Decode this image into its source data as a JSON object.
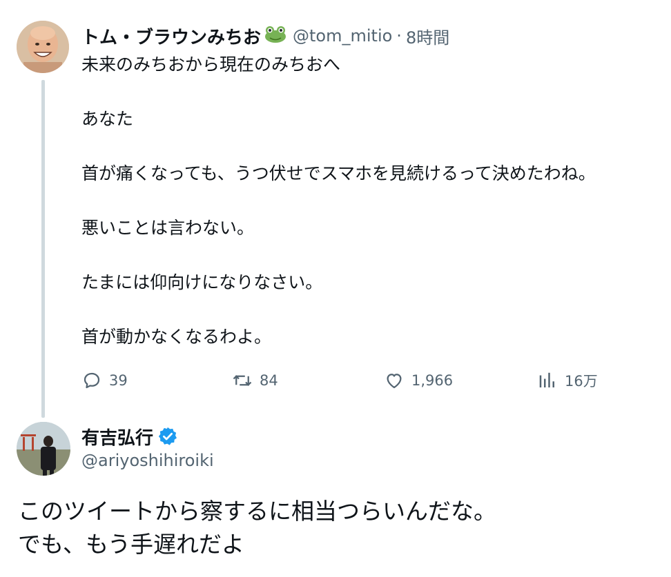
{
  "tweet1": {
    "name": "トム・ブラウンみちお",
    "handle": "@tom_mitio",
    "separator": "·",
    "time": "8時間",
    "lines": [
      "未来のみちおから現在のみちおへ",
      "あなた",
      "首が痛くなっても、うつ伏せでスマホを見続けるって決めたわね。",
      "悪いことは言わない。",
      "たまには仰向けになりなさい。",
      "首が動かなくなるわよ。"
    ],
    "stats": {
      "replies": "39",
      "retweets": "84",
      "likes": "1,966",
      "views": "16万"
    }
  },
  "tweet2": {
    "name": "有吉弘行",
    "handle": "@ariyoshihiroiki",
    "lines": [
      "このツイートから察するに相当つらいんだな。",
      "でも、もう手遅れだよ"
    ]
  },
  "colors": {
    "text": "#0f1419",
    "secondary": "#536471",
    "thread_line": "#cfd9de",
    "verified": "#1d9bf0"
  },
  "icons": [
    "reply-icon",
    "retweet-icon",
    "like-icon",
    "views-icon",
    "frog-emoji-icon",
    "verified-badge-icon"
  ]
}
